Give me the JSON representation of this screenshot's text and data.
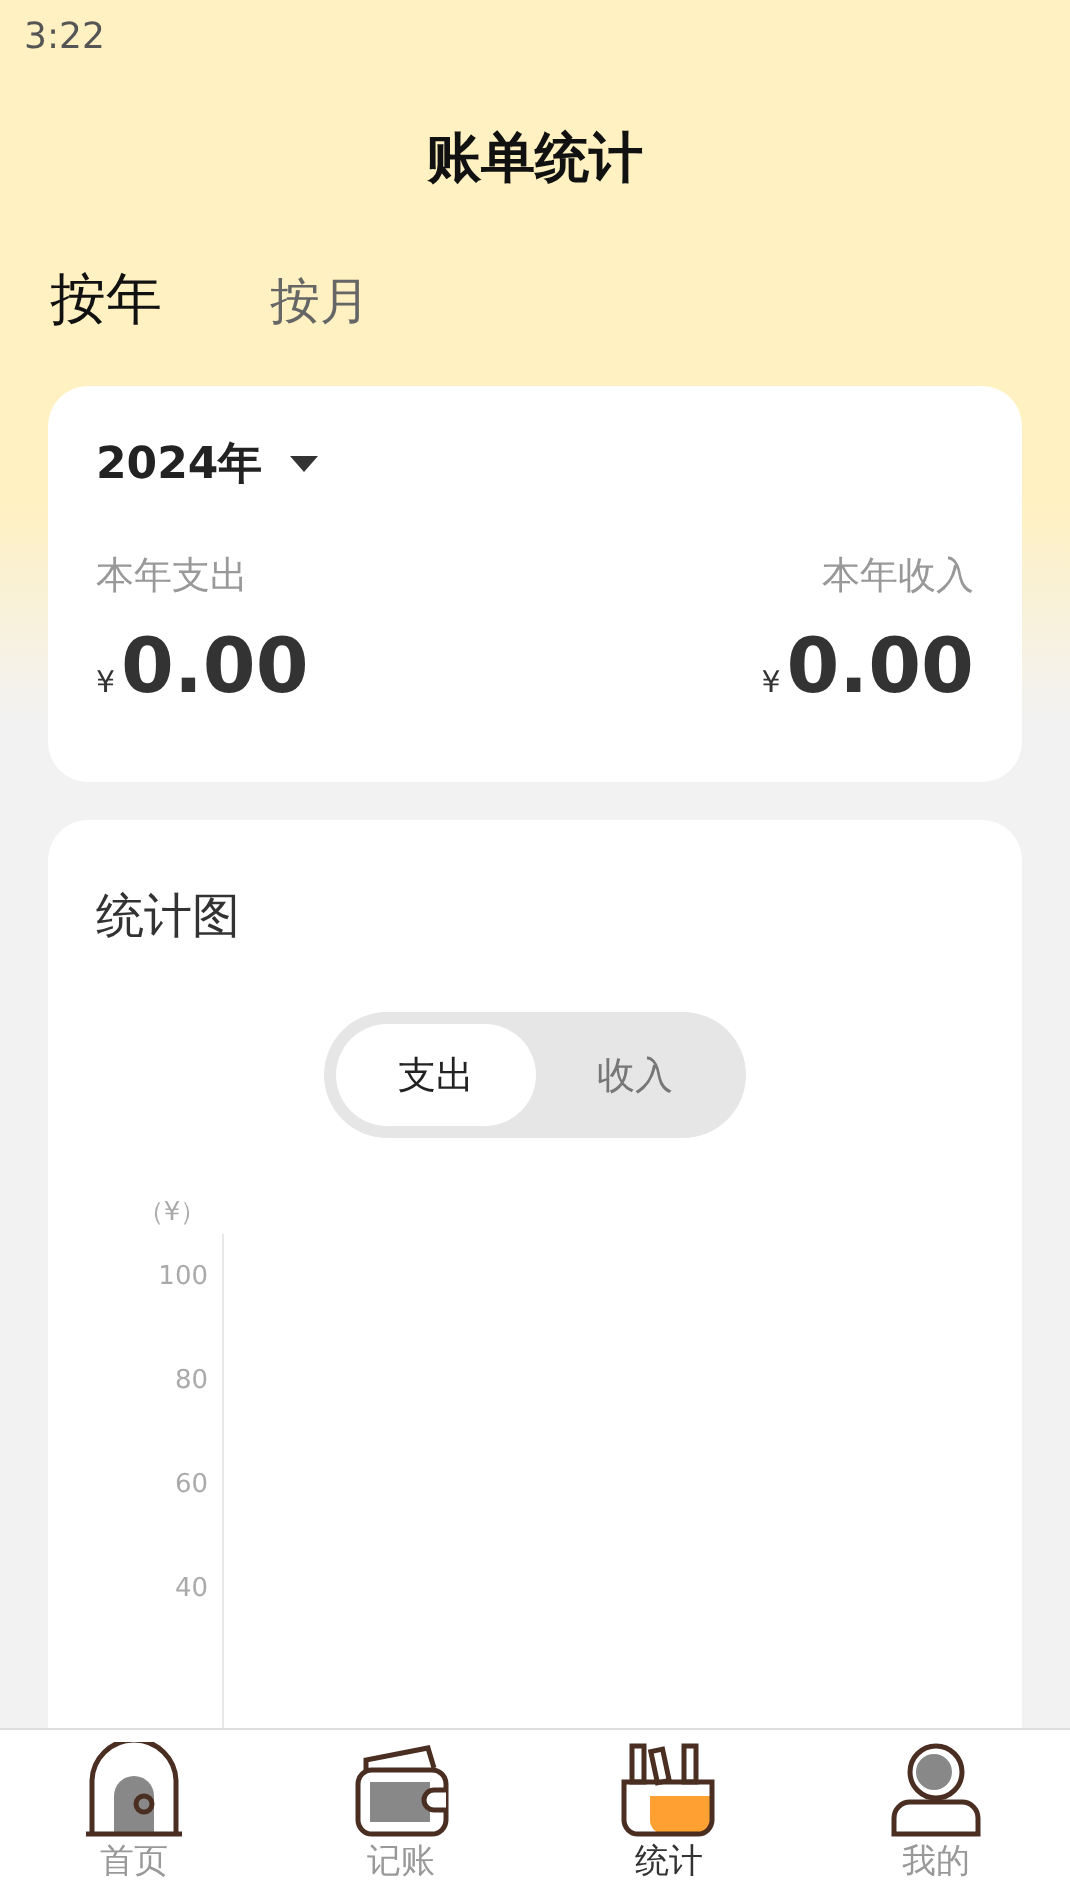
{
  "status_bar": {
    "time": "3:22"
  },
  "header": {
    "title": "账单统计"
  },
  "period_tabs": [
    {
      "label": "按年",
      "selected": true
    },
    {
      "label": "按月",
      "selected": false
    }
  ],
  "summary": {
    "year": "2024年",
    "expense_label": "本年支出",
    "expense_currency": "¥",
    "expense": "0.00",
    "income_label": "本年收入",
    "income_currency": "¥",
    "income": "0.00"
  },
  "chart_card": {
    "title": "统计图",
    "toggle": [
      {
        "label": "支出",
        "selected": true
      },
      {
        "label": "收入",
        "selected": false
      }
    ],
    "axis_unit": "（¥）",
    "axis_labels": [
      "100",
      "80",
      "60",
      "40"
    ]
  },
  "nav": [
    {
      "label": "首页",
      "kind": "home",
      "selected": false
    },
    {
      "label": "记账",
      "kind": "wallet",
      "selected": false
    },
    {
      "label": "统计",
      "kind": "stats",
      "selected": true
    },
    {
      "label": "我的",
      "kind": "profile",
      "selected": false
    }
  ]
}
